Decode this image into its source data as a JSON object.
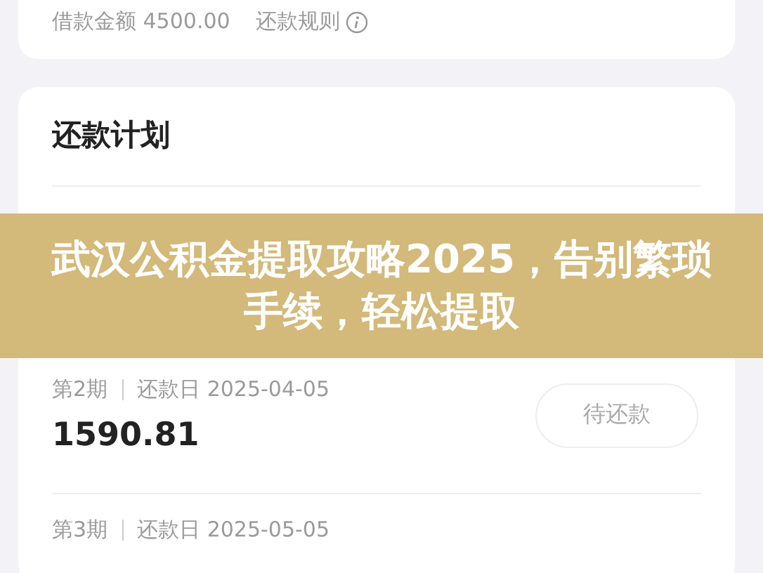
{
  "loan_summary": {
    "amount_label": "借款金额",
    "amount": "4500.00",
    "rules_link": "还款规则"
  },
  "plan": {
    "title": "还款计划",
    "rows": [
      {
        "period": "第2期",
        "due_label": "还款日",
        "due_date": "2025-04-05",
        "amount": "1590.81",
        "button": "待还款"
      },
      {
        "period": "第3期",
        "due_label": "还款日",
        "due_date": "2025-05-05"
      }
    ]
  },
  "banner": {
    "title": "武汉公积金提取攻略2025，告别繁琐手续，轻松提取"
  }
}
